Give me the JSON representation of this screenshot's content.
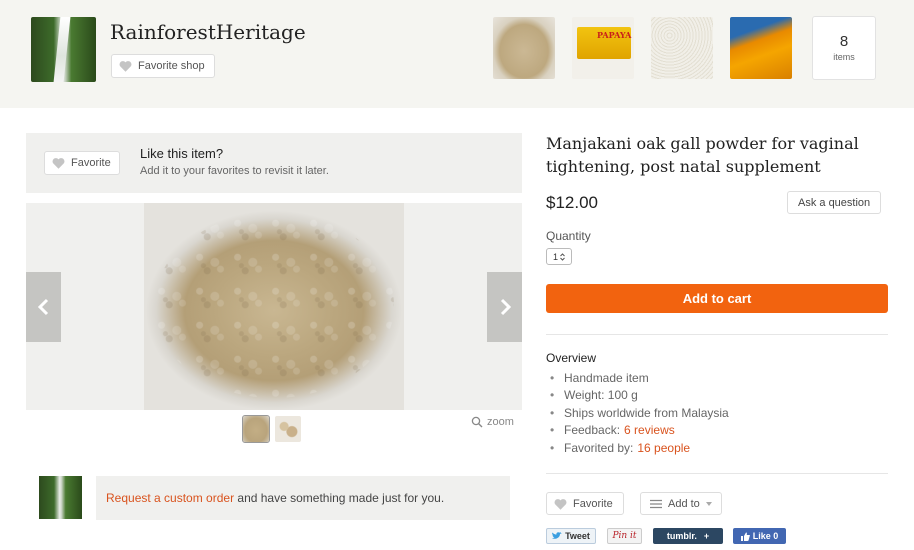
{
  "shop": {
    "name": "RainforestHeritage",
    "favorite_label": "Favorite shop",
    "items_count": "8",
    "items_label": "items",
    "thumb_papaya_text": "PAPAYA"
  },
  "like": {
    "favorite_label": "Favorite",
    "title": "Like this item?",
    "subtitle": "Add it to your favorites to revisit it later."
  },
  "gallery": {
    "zoom_label": "zoom"
  },
  "custom_order": {
    "link": "Request a custom order",
    "rest": " and have something made just for you."
  },
  "listing": {
    "title": "Manjakani oak gall powder for vaginal tightening, post natal supplement",
    "price": "$12.00",
    "ask_label": "Ask a question",
    "quantity_label": "Quantity",
    "quantity_value": "1",
    "cart_label": "Add to cart"
  },
  "overview": {
    "title": "Overview",
    "items": [
      {
        "text": "Handmade item"
      },
      {
        "text": "Weight: 100 g"
      },
      {
        "text": "Ships worldwide from Malaysia"
      },
      {
        "text": "Feedback:",
        "link": "6 reviews"
      },
      {
        "text": "Favorited by:",
        "link": "16 people"
      }
    ]
  },
  "actions": {
    "favorite_label": "Favorite",
    "addto_label": "Add to"
  },
  "share": {
    "tweet": "Tweet",
    "pin": "Pin it",
    "tumblr": "tumblr.",
    "like": "Like 0"
  },
  "colors": {
    "accent": "#f2630f",
    "link": "#d9531e"
  }
}
